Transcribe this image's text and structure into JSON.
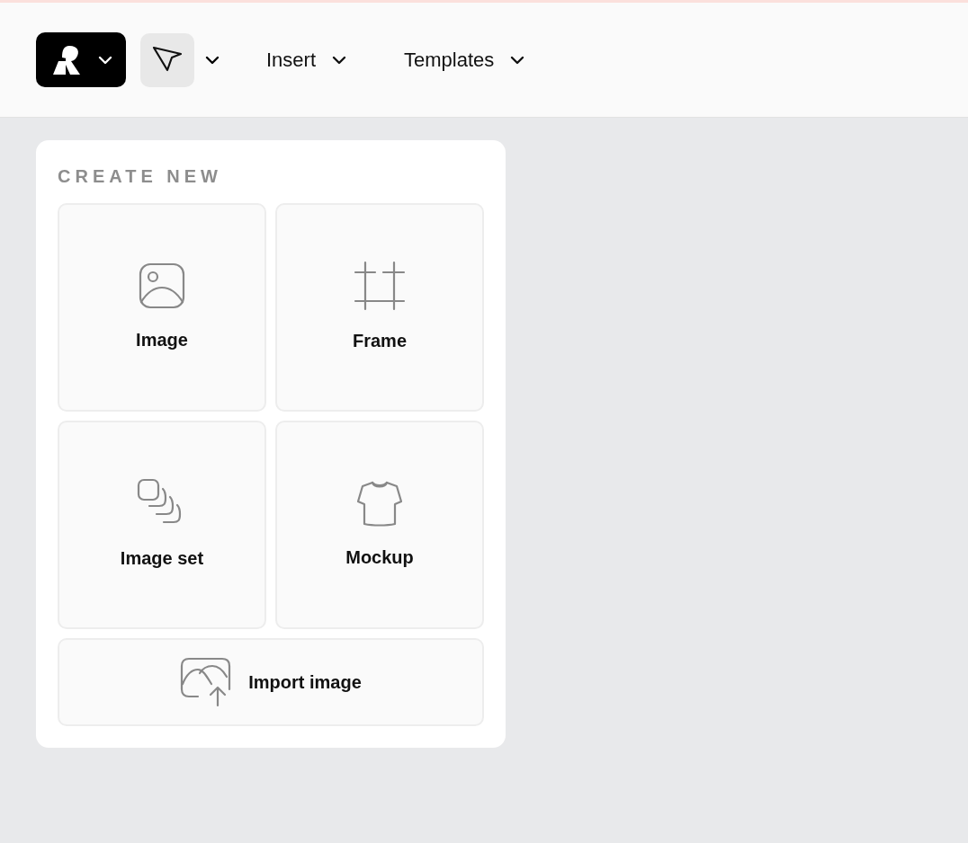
{
  "toolbar": {
    "tools": [
      {
        "kind": "pointer",
        "selected": true
      }
    ],
    "menus": [
      {
        "label": "Insert"
      },
      {
        "label": "Templates"
      }
    ]
  },
  "create_panel": {
    "heading": "CREATE NEW",
    "tiles": [
      {
        "kind": "image",
        "label": "Image"
      },
      {
        "kind": "frame",
        "label": "Frame"
      },
      {
        "kind": "image-set",
        "label": "Image set"
      },
      {
        "kind": "mockup",
        "label": "Mockup"
      },
      {
        "kind": "import",
        "label": "Import image"
      }
    ]
  }
}
